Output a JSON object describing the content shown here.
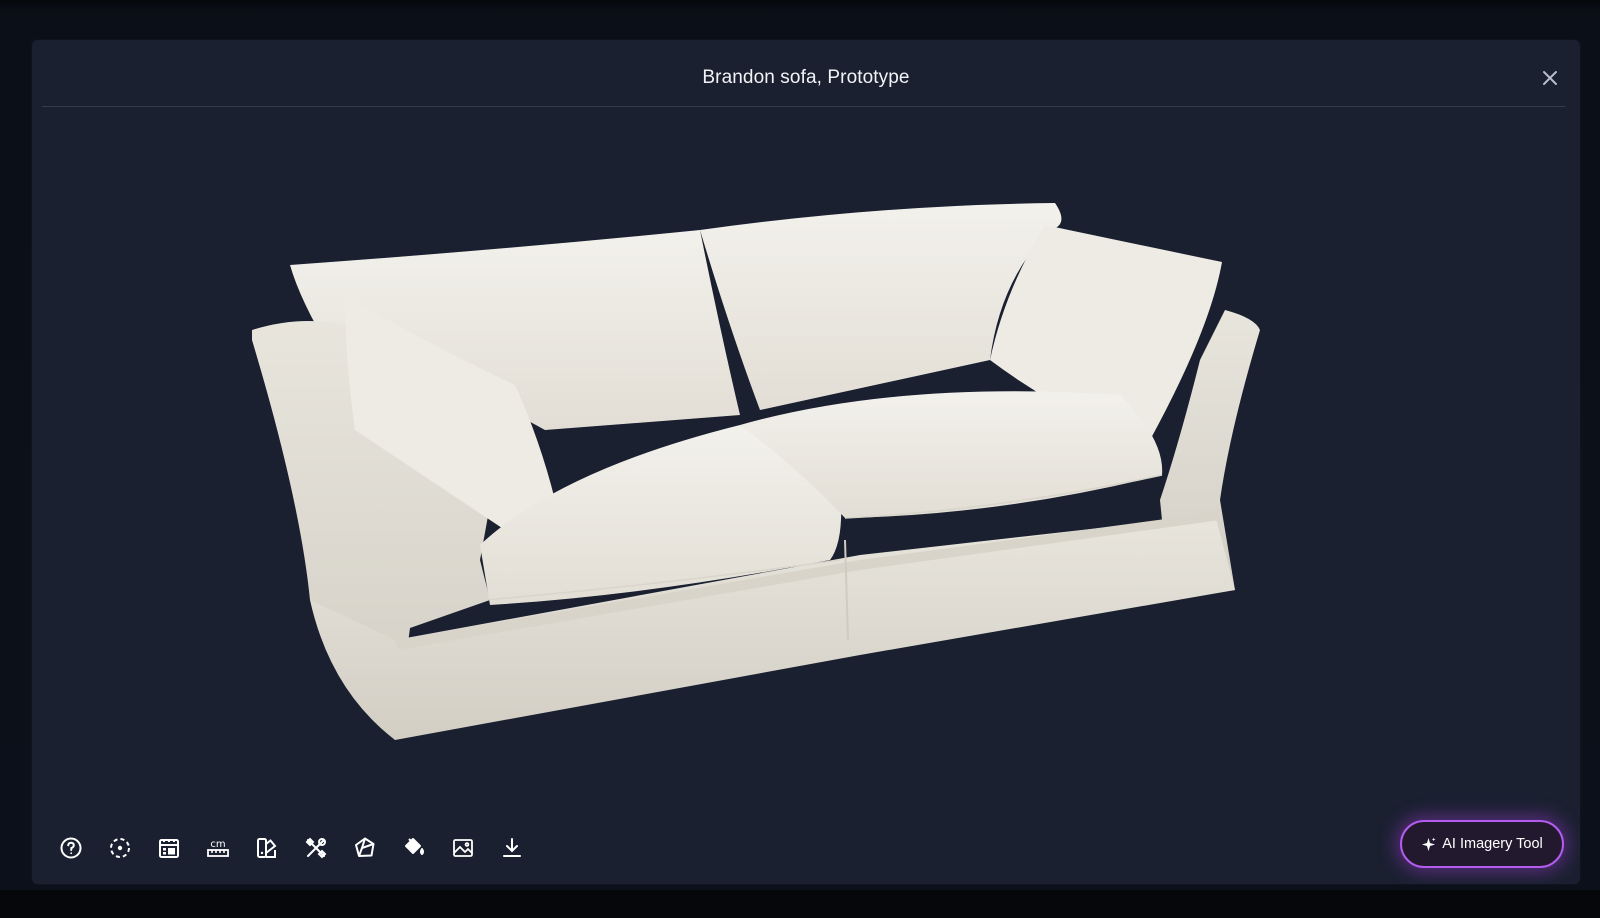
{
  "modal": {
    "title": "Brandon sofa, Prototype"
  },
  "toolbar": {
    "tools": [
      {
        "icon": "help-circle-icon"
      },
      {
        "icon": "focus-dashed-icon"
      },
      {
        "icon": "calendar-grid-icon"
      },
      {
        "icon": "ruler-cm-icon",
        "label": "cm"
      },
      {
        "icon": "swatch-palette-icon"
      },
      {
        "icon": "tools-wrench-icon"
      },
      {
        "icon": "polygon-wireframe-icon"
      },
      {
        "icon": "paint-bucket-icon"
      },
      {
        "icon": "image-icon"
      },
      {
        "icon": "download-icon"
      }
    ]
  },
  "ai_button": {
    "label": "AI Imagery Tool",
    "icon": "sparkle-icon"
  },
  "colors": {
    "modal_bg": "#1a2030",
    "accent_glow": "#b25cf0",
    "sofa_fabric": "#ece9e1"
  }
}
